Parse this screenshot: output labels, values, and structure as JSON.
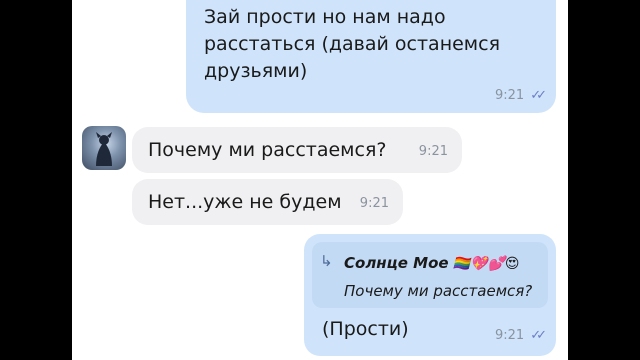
{
  "messages": [
    {
      "direction": "outgoing",
      "text": "Зай прости но нам надо расстаться (давай останемся друзьями)",
      "time": "9:21",
      "status": "read"
    },
    {
      "direction": "incoming",
      "text": "Почему ми расстаемся?",
      "time": "9:21"
    },
    {
      "direction": "incoming",
      "text": "Нет...уже не будем",
      "time": "9:21"
    },
    {
      "direction": "outgoing",
      "text": "(Прости)",
      "time": "9:21",
      "status": "read",
      "reply": {
        "author": "Солнце Мое",
        "author_emoji": "🏳️‍🌈💖💕😍",
        "text": "Почему ми расстаемся?"
      }
    }
  ],
  "icons": {
    "read_receipt": "double-check-icon",
    "reply": "reply-arrow-icon",
    "avatar": "avatar"
  },
  "colors": {
    "outgoing_bubble": "#cfe4fb",
    "incoming_bubble": "#f0f0f2",
    "read_check": "#6d7ec8",
    "time": "#8a93a0"
  }
}
